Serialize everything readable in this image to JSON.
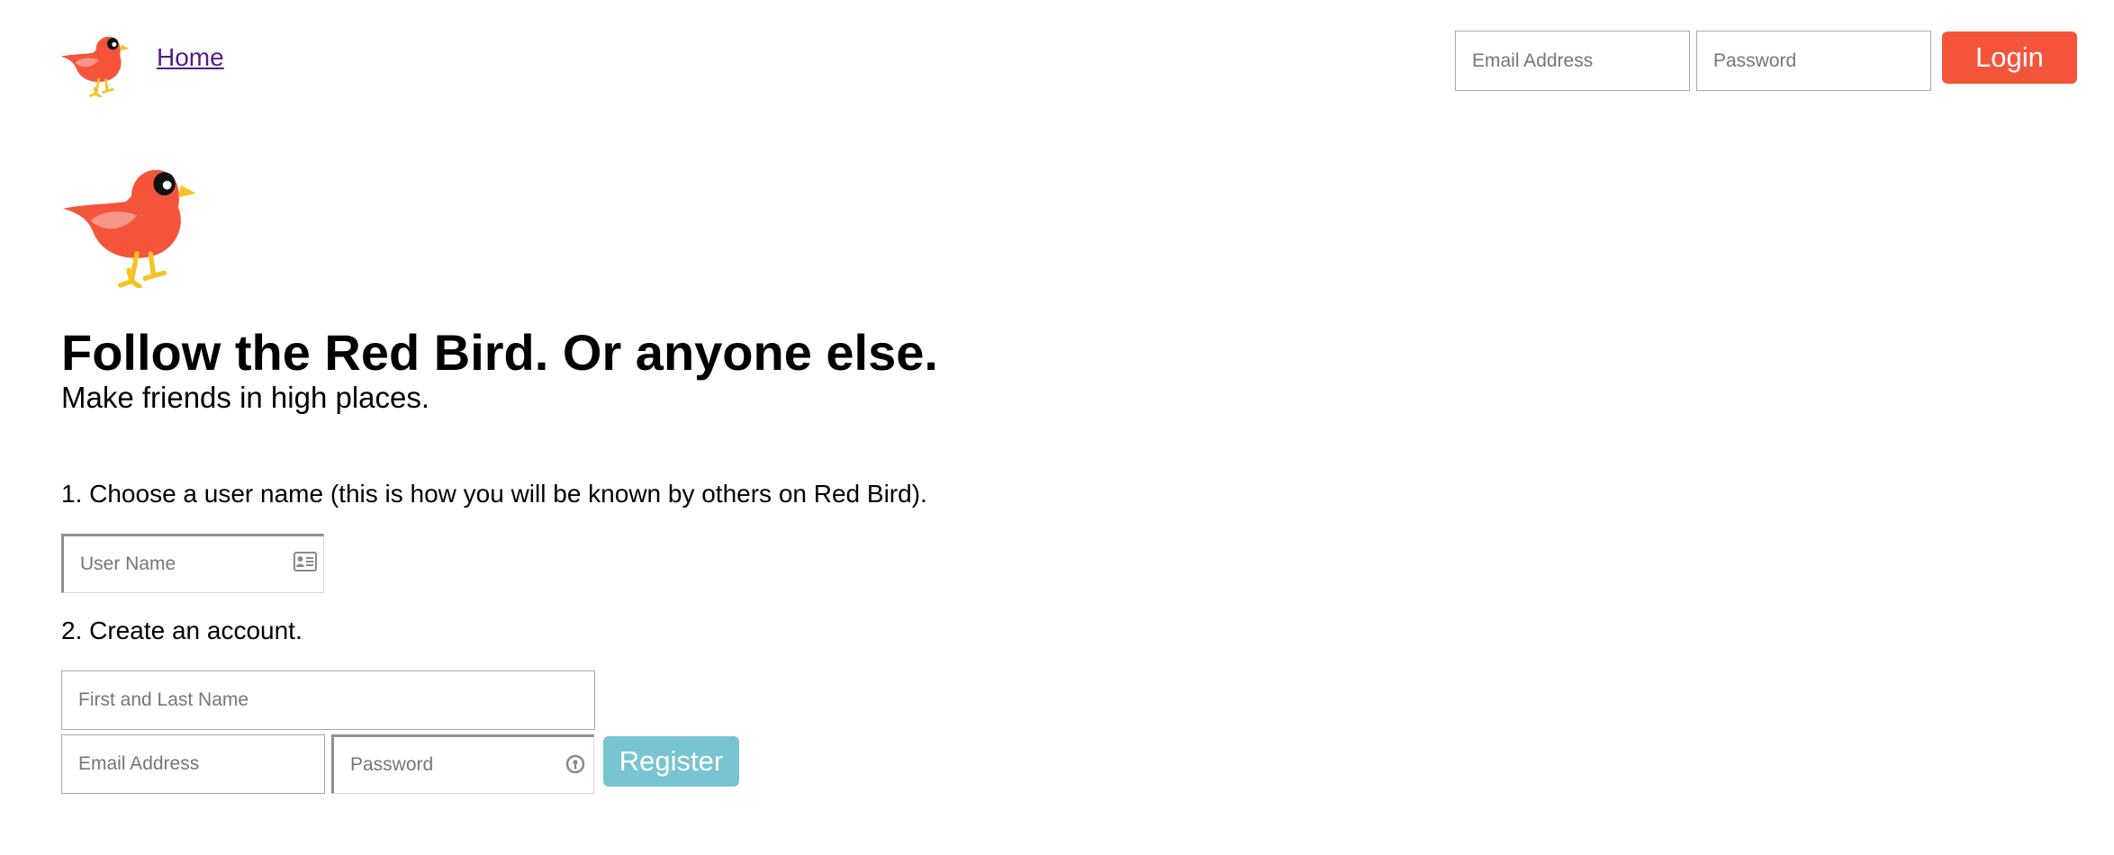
{
  "colors": {
    "bird_red": "#f4553a",
    "bird_wing": "#f8968a",
    "bird_beak": "#f7c223",
    "login_button": "#f4553a",
    "register_button": "#78c4d2",
    "home_link": "#551a8b"
  },
  "header": {
    "logo_icon": "red-bird-icon",
    "home_link": "Home",
    "email_placeholder": "Email Address",
    "password_placeholder": "Password",
    "login_label": "Login"
  },
  "hero": {
    "logo_icon": "red-bird-icon",
    "headline": "Follow the Red Bird. Or anyone else.",
    "subline": "Make friends in high places."
  },
  "signup": {
    "step1": "1. Choose a user name (this is how you will be known by others on Red Bird).",
    "username_placeholder": "User Name",
    "username_icon": "contact-card-icon",
    "step2": "2. Create an account.",
    "fullname_placeholder": "First and Last Name",
    "email_placeholder": "Email Address",
    "password_placeholder": "Password",
    "password_icon": "password-key-icon",
    "register_label": "Register"
  }
}
